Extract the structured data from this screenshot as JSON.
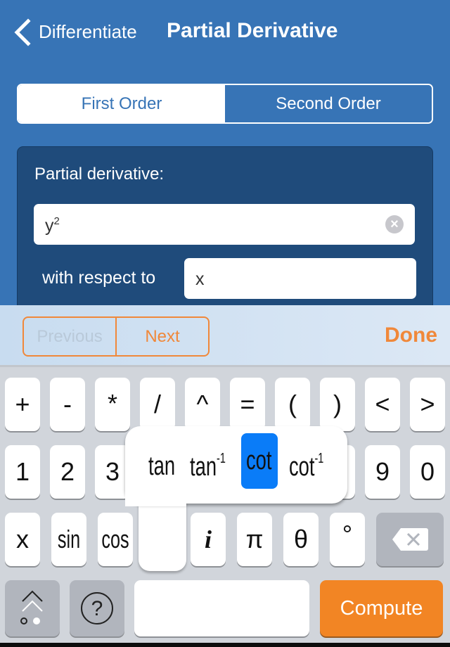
{
  "nav": {
    "back_label": "Differentiate",
    "title": "Partial Derivative",
    "back_icon": "chevron-left-icon"
  },
  "order_tabs": [
    {
      "label": "First Order",
      "selected": true
    },
    {
      "label": "Second Order",
      "selected": false
    }
  ],
  "form": {
    "label": "Partial derivative:",
    "expression_base": "y",
    "expression_exp": "2",
    "clear_icon": "×",
    "wrt_label": "with respect to",
    "wrt_value": "x"
  },
  "toolbar": {
    "previous_label": "Previous",
    "next_label": "Next",
    "done_label": "Done"
  },
  "keyboard": {
    "row1": [
      "+",
      "-",
      "*",
      "/",
      "^",
      "=",
      "(",
      ")",
      "<",
      ">"
    ],
    "row2": [
      "1",
      "2",
      "3",
      "9",
      "0"
    ],
    "row3": [
      "x",
      "sin",
      "cos",
      "i",
      "π",
      "θ",
      "°"
    ],
    "popup": [
      {
        "label": "tan",
        "sup": "",
        "selected": false
      },
      {
        "label": "tan",
        "sup": "-1",
        "selected": false
      },
      {
        "label": "cot",
        "sup": "",
        "selected": true
      },
      {
        "label": "cot",
        "sup": "-1",
        "selected": false
      }
    ],
    "backspace_icon": "×",
    "help_icon": "?",
    "compute_label": "Compute"
  },
  "colors": {
    "nav_bg": "#3774b6",
    "panel_bg": "#1f4b7b",
    "accent_orange": "#f28524",
    "selection_blue": "#0a7cf8"
  }
}
